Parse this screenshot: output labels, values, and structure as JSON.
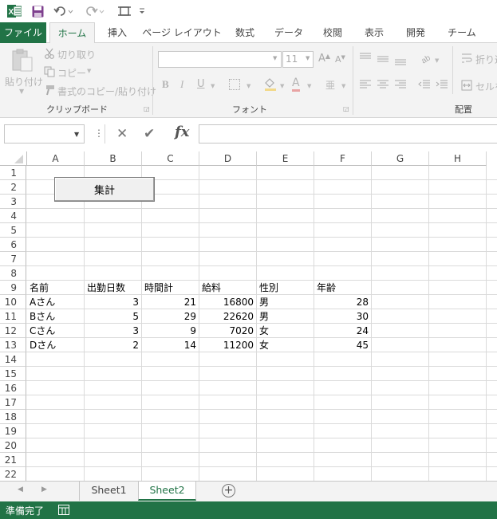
{
  "quick_access": {
    "excel_icon": "excel-logo-icon",
    "save_icon": "save-icon",
    "undo_icon": "undo-icon",
    "redo_icon": "redo-icon",
    "customize_icon": "customize-icon"
  },
  "tabs": [
    {
      "label": "ファイル"
    },
    {
      "label": "ホーム"
    },
    {
      "label": "挿入"
    },
    {
      "label": "ページ レイアウト"
    },
    {
      "label": "数式"
    },
    {
      "label": "データ"
    },
    {
      "label": "校閲"
    },
    {
      "label": "表示"
    },
    {
      "label": "開発"
    },
    {
      "label": "チーム"
    }
  ],
  "ribbon": {
    "paste": "貼り付け",
    "cut": "切り取り",
    "copy": "コピー",
    "format_painter": "書式のコピー/貼り付け",
    "clipboard_group": "クリップボード",
    "font_size": "11",
    "bold": "B",
    "italic": "I",
    "underline": "U",
    "font_color": "A",
    "font_group": "フォント",
    "wrap_text": "折り返",
    "merge": "セルを",
    "alignment_group": "配置"
  },
  "formula_bar": {
    "name_box": "",
    "cancel": "✕",
    "enter": "✔",
    "fx": "fx",
    "formula": ""
  },
  "columns": [
    "A",
    "B",
    "C",
    "D",
    "E",
    "F",
    "G",
    "H"
  ],
  "rows": [
    "1",
    "2",
    "3",
    "4",
    "5",
    "6",
    "7",
    "8",
    "9",
    "10",
    "11",
    "12",
    "13",
    "14",
    "15",
    "16",
    "17",
    "18",
    "19",
    "20",
    "21",
    "22"
  ],
  "button_label": "集計",
  "table": {
    "headers": [
      "名前",
      "出勤日数",
      "時間計",
      "給料",
      "性別",
      "年齢"
    ],
    "rows": [
      [
        "Aさん",
        "3",
        "21",
        "16800",
        "男",
        "28"
      ],
      [
        "Bさん",
        "5",
        "29",
        "22620",
        "男",
        "30"
      ],
      [
        "Cさん",
        "3",
        "9",
        "7020",
        "女",
        "24"
      ],
      [
        "Dさん",
        "2",
        "14",
        "11200",
        "女",
        "45"
      ]
    ]
  },
  "sheets": [
    "Sheet1",
    "Sheet2"
  ],
  "active_sheet": "Sheet2",
  "status": {
    "text": "準備完了"
  },
  "colors": {
    "accent": "#217346",
    "ribbon_bg": "#f3f3f3"
  }
}
